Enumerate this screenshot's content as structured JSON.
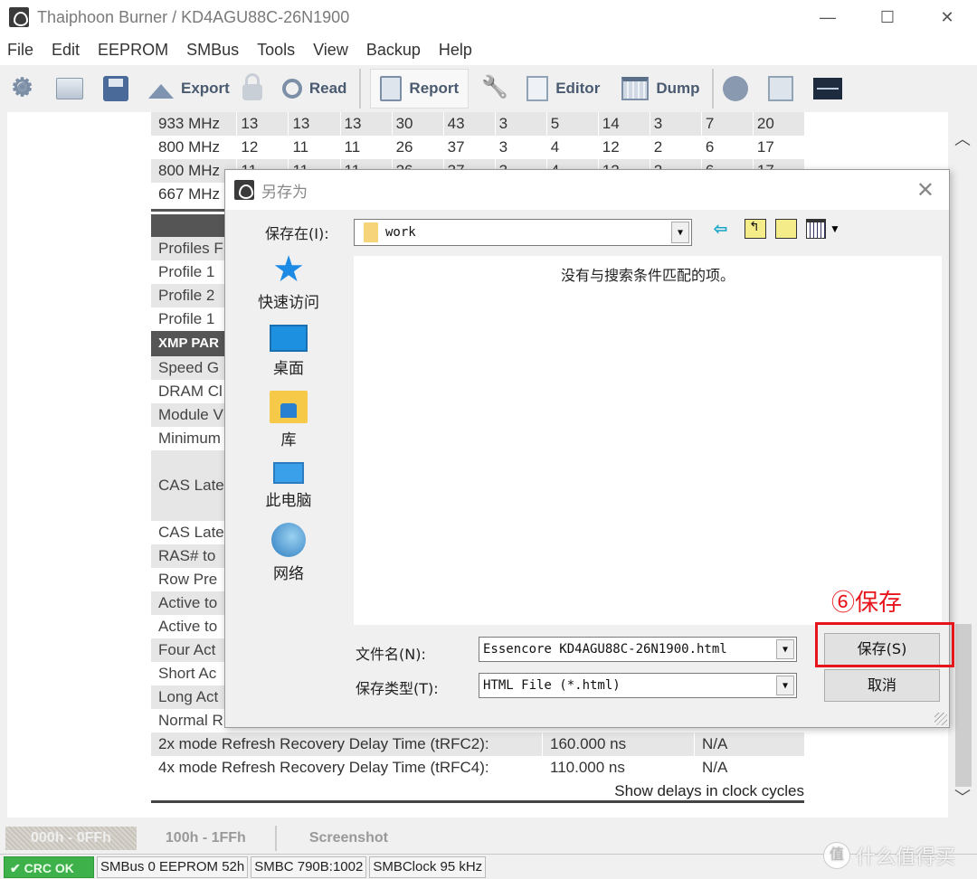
{
  "window": {
    "title": "Thaiphoon Burner / KD4AGU88C-26N1900",
    "controls": {
      "minimize": "—",
      "maximize": "☐",
      "close": "✕"
    }
  },
  "menu": [
    "File",
    "Edit",
    "EEPROM",
    "SMBus",
    "Tools",
    "View",
    "Backup",
    "Help"
  ],
  "toolbar": {
    "export_label": "Export",
    "read_label": "Read",
    "report_label": "Report",
    "editor_label": "Editor",
    "dump_label": "Dump",
    "icons": [
      "gear-icon",
      "open-folder-icon",
      "save-icon",
      "export-icon",
      "lock-icon",
      "read-icon",
      "report-icon",
      "wrench-icon",
      "editor-icon",
      "dump-icon",
      "inspect-icon",
      "copy-icon",
      "waveform-icon"
    ]
  },
  "report": {
    "freq_table": [
      [
        "933 MHz",
        "13",
        "13",
        "13",
        "30",
        "43",
        "3",
        "5",
        "14",
        "3",
        "7",
        "20"
      ],
      [
        "800 MHz",
        "12",
        "11",
        "11",
        "26",
        "37",
        "3",
        "4",
        "12",
        "2",
        "6",
        "17"
      ],
      [
        "800 MHz",
        "11",
        "11",
        "11",
        "26",
        "37",
        "3",
        "4",
        "12",
        "2",
        "6",
        "17"
      ],
      [
        "667 MHz",
        "",
        "",
        "",
        "",
        "",
        "",
        "",
        "",
        "",
        "",
        ""
      ]
    ],
    "profile_rows": [
      "Profiles F",
      "Profile 1",
      "Profile 2",
      "Profile 1"
    ],
    "xmp_header": "XMP PAR",
    "xmp_rows": [
      "Speed G",
      "DRAM Cl",
      "Module V",
      "Minimum",
      "CAS Late",
      "CAS Late",
      "RAS# to",
      "Row Pre",
      "Active to",
      "Active to",
      "Four Act",
      "Short Ac",
      "Long Act",
      "Normal R"
    ],
    "timing_rows": [
      {
        "label": "2x mode Refresh Recovery Delay Time (tRFC2):",
        "value": "160.000 ns",
        "xmp": "N/A"
      },
      {
        "label": "4x mode Refresh Recovery Delay Time (tRFC4):",
        "value": "110.000 ns",
        "xmp": "N/A"
      }
    ],
    "show_delays_link": "Show delays in clock cycles"
  },
  "bottom_tabs": [
    "000h - 0FFh",
    "100h - 1FFh",
    "Screenshot"
  ],
  "statusbar": {
    "crc": "✔ CRC OK",
    "smbus": "SMBus 0 EEPROM 52h",
    "smbc": "SMBC 790B:1002",
    "clock": "SMBClock 95 kHz"
  },
  "watermark": {
    "circle": "值",
    "text": "什么值得买"
  },
  "dialog": {
    "title": "另存为",
    "close": "✕",
    "look_in_label": "保存在(I):",
    "look_in_value": "work",
    "places": [
      {
        "label": "快速访问",
        "icon": "quick-access-icon"
      },
      {
        "label": "桌面",
        "icon": "desktop-icon"
      },
      {
        "label": "库",
        "icon": "library-icon"
      },
      {
        "label": "此电脑",
        "icon": "this-pc-icon"
      },
      {
        "label": "网络",
        "icon": "network-icon"
      }
    ],
    "empty_message": "没有与搜索条件匹配的项。",
    "filename_label": "文件名(N):",
    "filename_value": "Essencore KD4AGU88C-26N1900.html",
    "filetype_label": "保存类型(T):",
    "filetype_value": "HTML File (*.html)",
    "save_button": "保存(S)",
    "cancel_button": "取消",
    "annotation": "⑥保存",
    "highlight_color": "#e8141b"
  }
}
